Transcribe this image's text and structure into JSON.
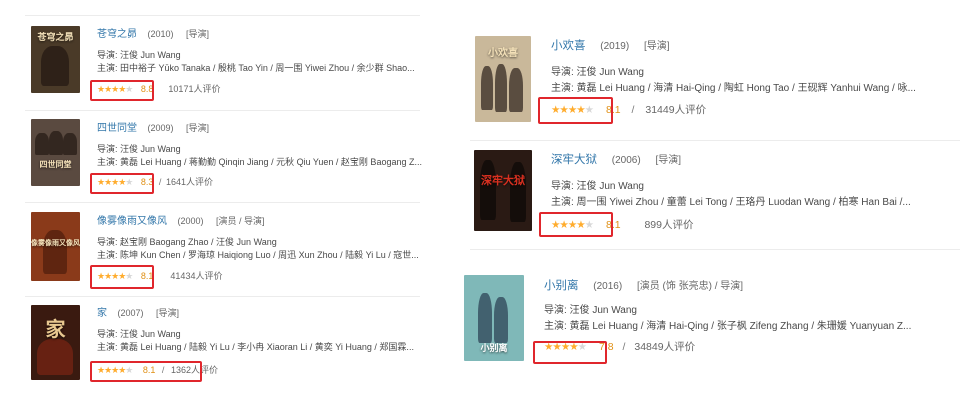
{
  "left_items": [
    {
      "title": "苍穹之昴",
      "year": "(2010)",
      "roles": "[导演]",
      "director": "导演: 汪俊 Jun Wang",
      "cast": "主演: 田中裕子 Yūko Tanaka / 殷桃 Tao Yin / 周一围 Yiwei Zhou / 余少群 Shao...",
      "stars": "★★★★",
      "stars_off": "★",
      "score": "8.8",
      "sep": "",
      "count": "10171人评价",
      "poster_text": "苍穹之昴",
      "poster_color": "#4a3a28"
    },
    {
      "title": "四世同堂",
      "year": "(2009)",
      "roles": "[导演]",
      "director": "导演: 汪俊 Jun Wang",
      "cast": "主演: 黄磊 Lei Huang / 蒋勤勤 Qinqin Jiang / 元秋 Qiu Yuen / 赵宝刚 Baogang Z...",
      "stars": "★★★★",
      "stars_off": "★",
      "score": "8.3",
      "sep": "/",
      "count": "1641人评价",
      "poster_text": "四世同堂",
      "poster_color": "#5a4a40"
    },
    {
      "title": "像雾像雨又像风",
      "year": "(2000)",
      "roles": "[演员 / 导演]",
      "director": "导演: 赵宝刚 Baogang Zhao / 汪俊 Jun Wang",
      "cast": "主演: 陈坤 Kun Chen / 罗海琼 Haiqiong Luo / 周迅 Xun Zhou / 陆毅 Yi Lu / 寇世...",
      "stars": "★★★★",
      "stars_off": "★",
      "score": "8.1",
      "sep": "",
      "count": "41434人评价",
      "poster_text": "像雾像雨又像风",
      "poster_color": "#8a3a1a"
    },
    {
      "title": "家",
      "year": "(2007)",
      "roles": "[导演]",
      "director": "导演: 汪俊 Jun Wang",
      "cast": "主演: 黄磊 Lei Huang / 陆毅 Yi Lu / 李小冉 Xiaoran Li / 黄奕 Yi Huang / 郑国霖...",
      "stars": "★★★★",
      "stars_off": "★",
      "score": "8.1",
      "sep": "/",
      "count": "1362人评价",
      "poster_text": "家",
      "poster_color": "#3a1a10"
    }
  ],
  "right_items": [
    {
      "title": "小欢喜",
      "year": "(2019)",
      "roles": "[导演]",
      "director": "导演: 汪俊 Jun Wang",
      "cast": "主演: 黄磊 Lei Huang / 海清 Hai-Qing / 陶虹 Hong Tao / 王砚辉 Yanhui Wang / 咏...",
      "stars": "★★★★",
      "stars_off": "★",
      "score": "8.1",
      "sep": "/",
      "count": "31449人评价",
      "poster_text": "小欢喜",
      "poster_color": "#c9b89a"
    },
    {
      "title": "深牢大狱",
      "year": "(2006)",
      "roles": "[导演]",
      "director": "导演: 汪俊 Jun Wang",
      "cast": "主演: 周一围 Yiwei Zhou / 童蕾 Lei Tong / 王珞丹 Luodan Wang / 柏寒 Han Bai /...",
      "stars": "★★★★",
      "stars_off": "★",
      "score": "8.1",
      "sep": "",
      "count": "899人评价",
      "poster_text": "深牢大狱",
      "poster_color": "#2a1a14"
    },
    {
      "title": "小别离",
      "year": "(2016)",
      "roles": "[演员 (饰 张亮忠) / 导演]",
      "director": "导演: 汪俊 Jun Wang",
      "cast": "主演: 黄磊 Lei Huang / 海清 Hai-Qing / 张子枫 Zifeng Zhang / 朱珊媛 Yuanyuan Z...",
      "stars": "★★★★",
      "stars_off": "★",
      "score": "7.8",
      "sep": "/",
      "count": "34849人评价",
      "poster_text": "小别离",
      "poster_color": "#7fb8b8"
    }
  ]
}
